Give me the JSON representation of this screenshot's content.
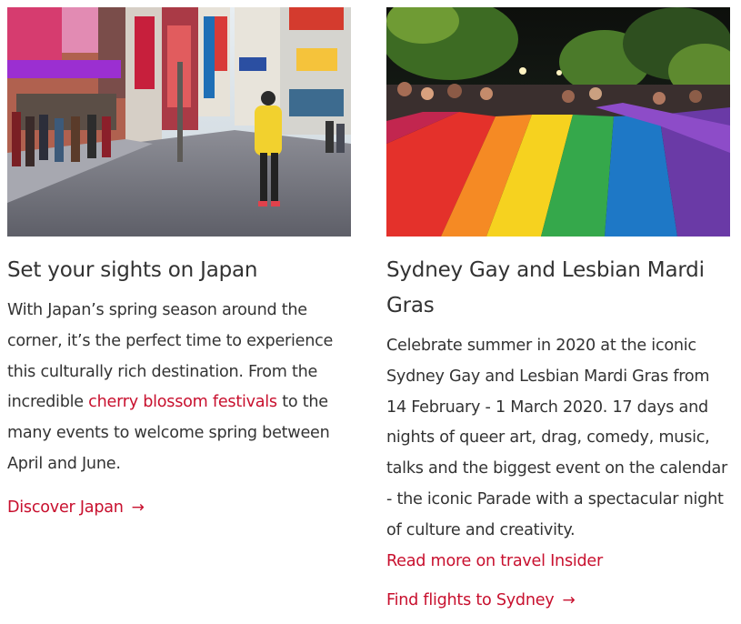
{
  "cards": [
    {
      "title": "Set your sights on Japan",
      "body_before_link": "With Japan’s spring season around the corner, it’s the perfect time to experience this culturally rich destination. From the incredible ",
      "inline_link": "cherry blossom festivals",
      "body_after_link": " to the many events to welcome spring between April and June.",
      "cta_label": "Discover Japan",
      "cta_icon": "arrow-right-icon",
      "image_subject": "tokyo-street-photo"
    },
    {
      "title": "Sydney Gay and Lesbian Mardi Gras",
      "body": "Celebrate summer in 2020 at the iconic Sydney Gay and Lesbian Mardi Gras from 14 February - 1 March 2020. 17 days and nights of queer art, drag, comedy, music, talks and the biggest event on the calendar - the iconic Parade with a spectacular night of culture and creativity.",
      "read_more": "Read more on travel Insider",
      "cta_label": "Find flights to Sydney",
      "cta_icon": "arrow-right-icon",
      "image_subject": "rainbow-flag-parade-photo"
    }
  ],
  "colors": {
    "link": "#c8102e",
    "text": "#333333",
    "heading": "#323232"
  }
}
